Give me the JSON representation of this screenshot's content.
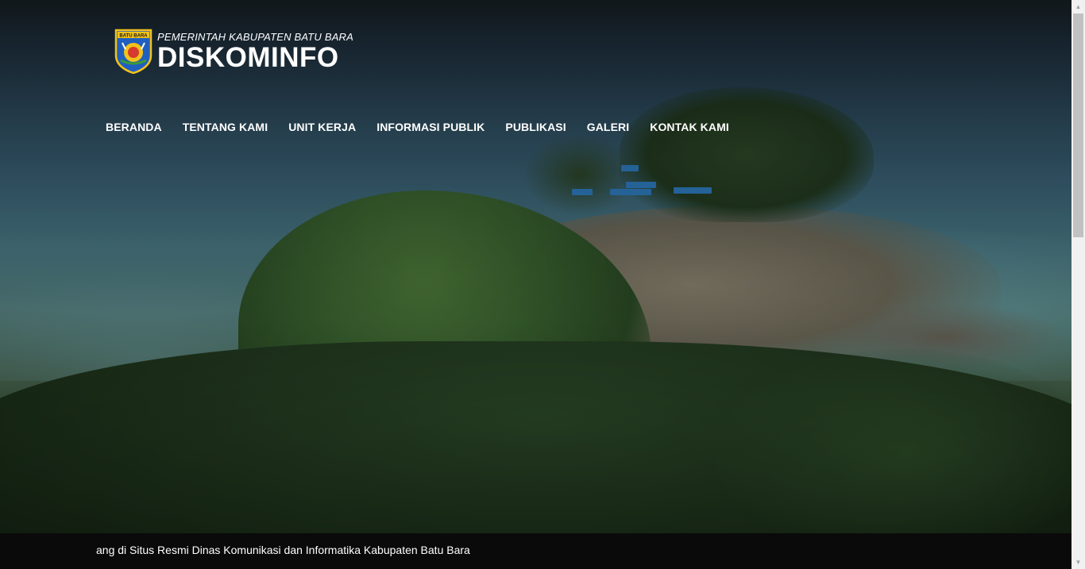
{
  "header": {
    "brand_subtitle": "PEMERINTAH KABUPATEN BATU BARA",
    "brand_title": "DISKOMINFO",
    "crest_label": "BATU BARA",
    "crest_icon": "regency-crest-icon"
  },
  "nav": {
    "items": [
      {
        "label": "BERANDA"
      },
      {
        "label": "TENTANG KAMI"
      },
      {
        "label": "UNIT KERJA"
      },
      {
        "label": "INFORMASI PUBLIK"
      },
      {
        "label": "PUBLIKASI"
      },
      {
        "label": "GALERI"
      },
      {
        "label": "KONTAK KAMI"
      }
    ]
  },
  "ticker": {
    "text": "ang di Situs Resmi Dinas Komunikasi dan Informatika Kabupaten Batu Bara"
  },
  "scrollbar": {
    "up_icon": "scroll-up-arrow-icon",
    "down_icon": "scroll-down-arrow-icon",
    "position_fraction": 0.0
  },
  "colors": {
    "nav_text": "#ffffff",
    "ticker_bg": "#0a0a0a",
    "roof_blue": "#2f7fc4"
  }
}
